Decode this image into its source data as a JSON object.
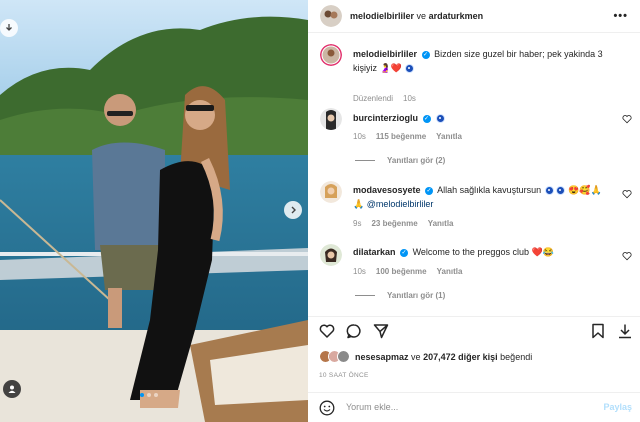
{
  "header": {
    "user1": "melodielbirliler",
    "connector": "ve",
    "user2": "ardaturkmen",
    "more": "•••"
  },
  "caption": {
    "username": "melodielbirliler",
    "text": "Bizden size guzel bir haber; pek yakinda 3 kişiyiz",
    "emoji": "🤰❤️",
    "edited": "Düzenlendi",
    "time": "10s"
  },
  "comments": [
    {
      "username": "burcinterzioglu",
      "text": "",
      "time": "10s",
      "likes": "115 beğenme",
      "reply": "Yanıtla",
      "view_replies": "Yanıtları gör (2)"
    },
    {
      "username": "modavesosyete",
      "text": "Allah sağlıkla kavuştursun",
      "emoji": "😍🥰🙏",
      "mention": "@melodielbirliler",
      "time": "9s",
      "likes": "23 beğenme",
      "reply": "Yanıtla"
    },
    {
      "username": "dilatarkan",
      "text": "Welcome to the preggos club",
      "emoji": "❤️😂",
      "time": "10s",
      "likes": "100 beğenme",
      "reply": "Yanıtla",
      "view_replies": "Yanıtları gör (1)"
    }
  ],
  "likes": {
    "first_user": "nesesapmaz",
    "connector": "ve",
    "count": "207,472",
    "rest": "diğer kişi",
    "suffix": "beğendi"
  },
  "posted_ago": "10 SAAT ÖNCE",
  "add_comment": {
    "placeholder": "Yorum ekle...",
    "post": "Paylaş"
  },
  "colors": {
    "accent": "#0095f6",
    "secondary_text": "#8e8e8e",
    "heart_red": "#ed4956"
  },
  "icons": [
    "download-icon",
    "next-arrow-icon",
    "user-tag-icon",
    "more-icon",
    "heart-icon",
    "comment-icon",
    "share-icon",
    "bookmark-icon",
    "emoji-icon"
  ]
}
